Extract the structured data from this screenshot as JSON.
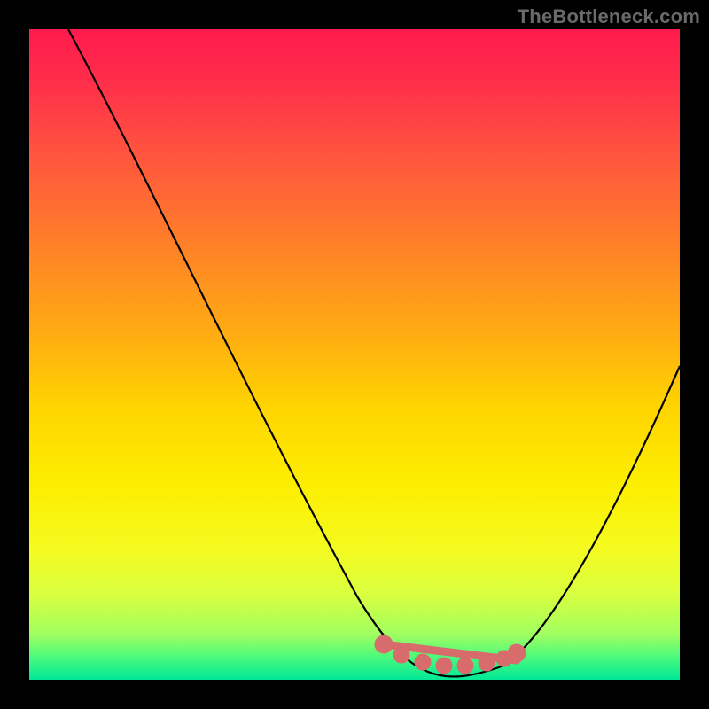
{
  "watermark": "TheBottleneck.com",
  "chart_data": {
    "type": "line",
    "title": "",
    "xlabel": "",
    "ylabel": "",
    "xlim": [
      0,
      100
    ],
    "ylim": [
      0,
      100
    ],
    "series": [
      {
        "name": "curve",
        "x": [
          6,
          12,
          18,
          24,
          30,
          36,
          42,
          46,
          50,
          54,
          58,
          62,
          66,
          70,
          74,
          78,
          82,
          86,
          90,
          96,
          100
        ],
        "y": [
          100,
          90,
          80,
          70,
          60,
          50,
          40,
          32,
          24,
          16,
          9,
          4,
          1,
          0,
          0.5,
          3,
          8,
          15,
          24,
          40,
          52
        ]
      }
    ],
    "markers": {
      "name": "highlight-dots",
      "color": "#d86b6b",
      "x": [
        55,
        58,
        60,
        62,
        64,
        66,
        68,
        70,
        72,
        74,
        75
      ],
      "y": [
        7,
        4,
        2.5,
        1.5,
        1,
        0.5,
        0.5,
        0.5,
        1,
        2,
        3
      ]
    },
    "background_gradient": {
      "top": "#ff1a4d",
      "bottom": "#00e898"
    }
  }
}
